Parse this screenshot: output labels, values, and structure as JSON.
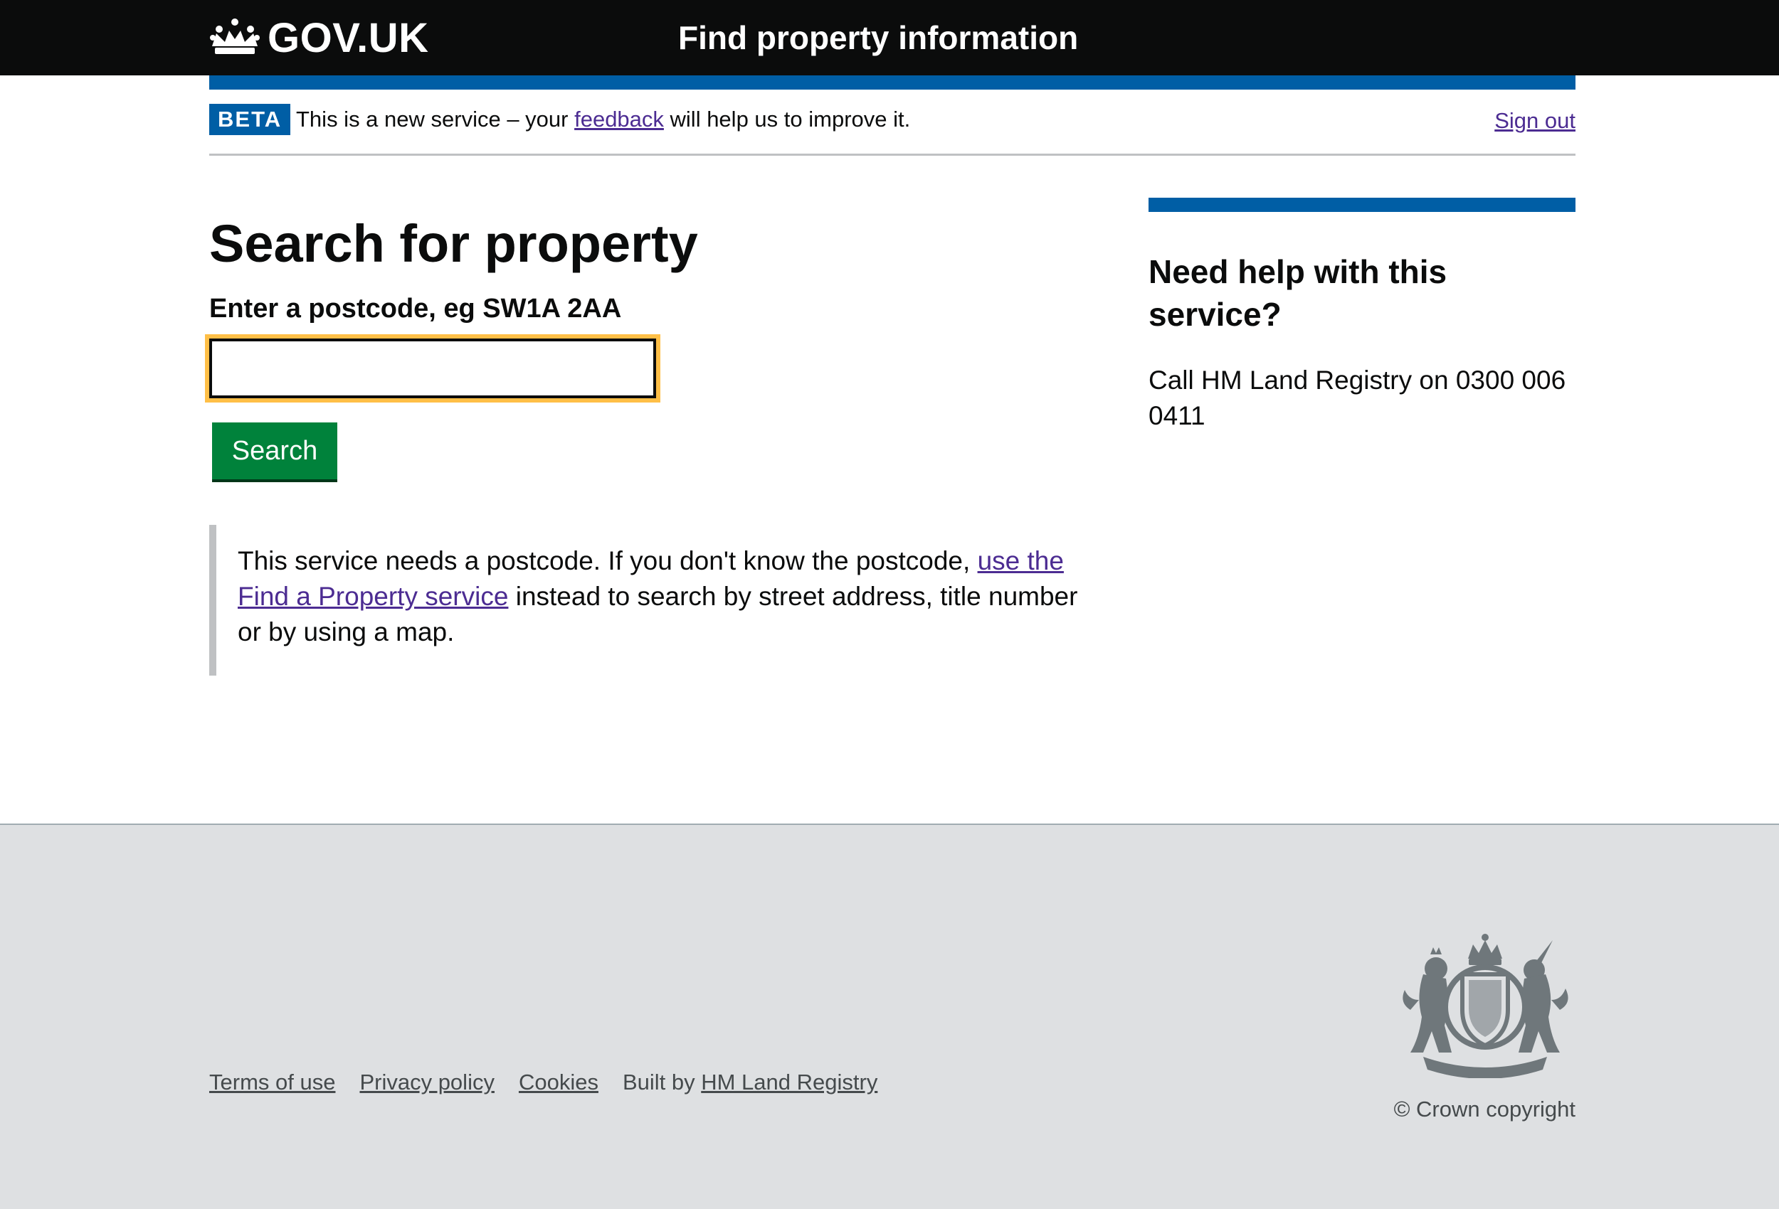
{
  "header": {
    "logo_text": "GOV.UK",
    "service_name": "Find property information"
  },
  "phase_banner": {
    "tag": "BETA",
    "text_before": "This is a new service – your ",
    "feedback_link": "feedback",
    "text_after": " will help us to improve it.",
    "sign_out": "Sign out"
  },
  "main": {
    "title": "Search for property",
    "postcode_label": "Enter a postcode, eg SW1A 2AA",
    "postcode_value": "",
    "search_button": "Search",
    "inset_before": "This service needs a postcode. If you don't know the postcode, ",
    "inset_link": "use the Find a Property service",
    "inset_after": " instead to search by street address, title number or by using a map."
  },
  "sidebar": {
    "title": "Need help with this service?",
    "text": "Call HM Land Registry on 0300 006 0411"
  },
  "footer": {
    "terms": "Terms of use",
    "privacy": "Privacy policy",
    "cookies": "Cookies",
    "built_by_prefix": "Built by ",
    "built_by_link": "HM Land Registry",
    "copyright": "© Crown copyright",
    "crest_icon": "royal-coat-of-arms-icon"
  },
  "colors": {
    "header_bg": "#0b0c0c",
    "brand_blue": "#005ea5",
    "button_green": "#00823b",
    "focus_yellow": "#ffbf47",
    "link_purple": "#4c2c92",
    "footer_bg": "#dee0e2"
  }
}
